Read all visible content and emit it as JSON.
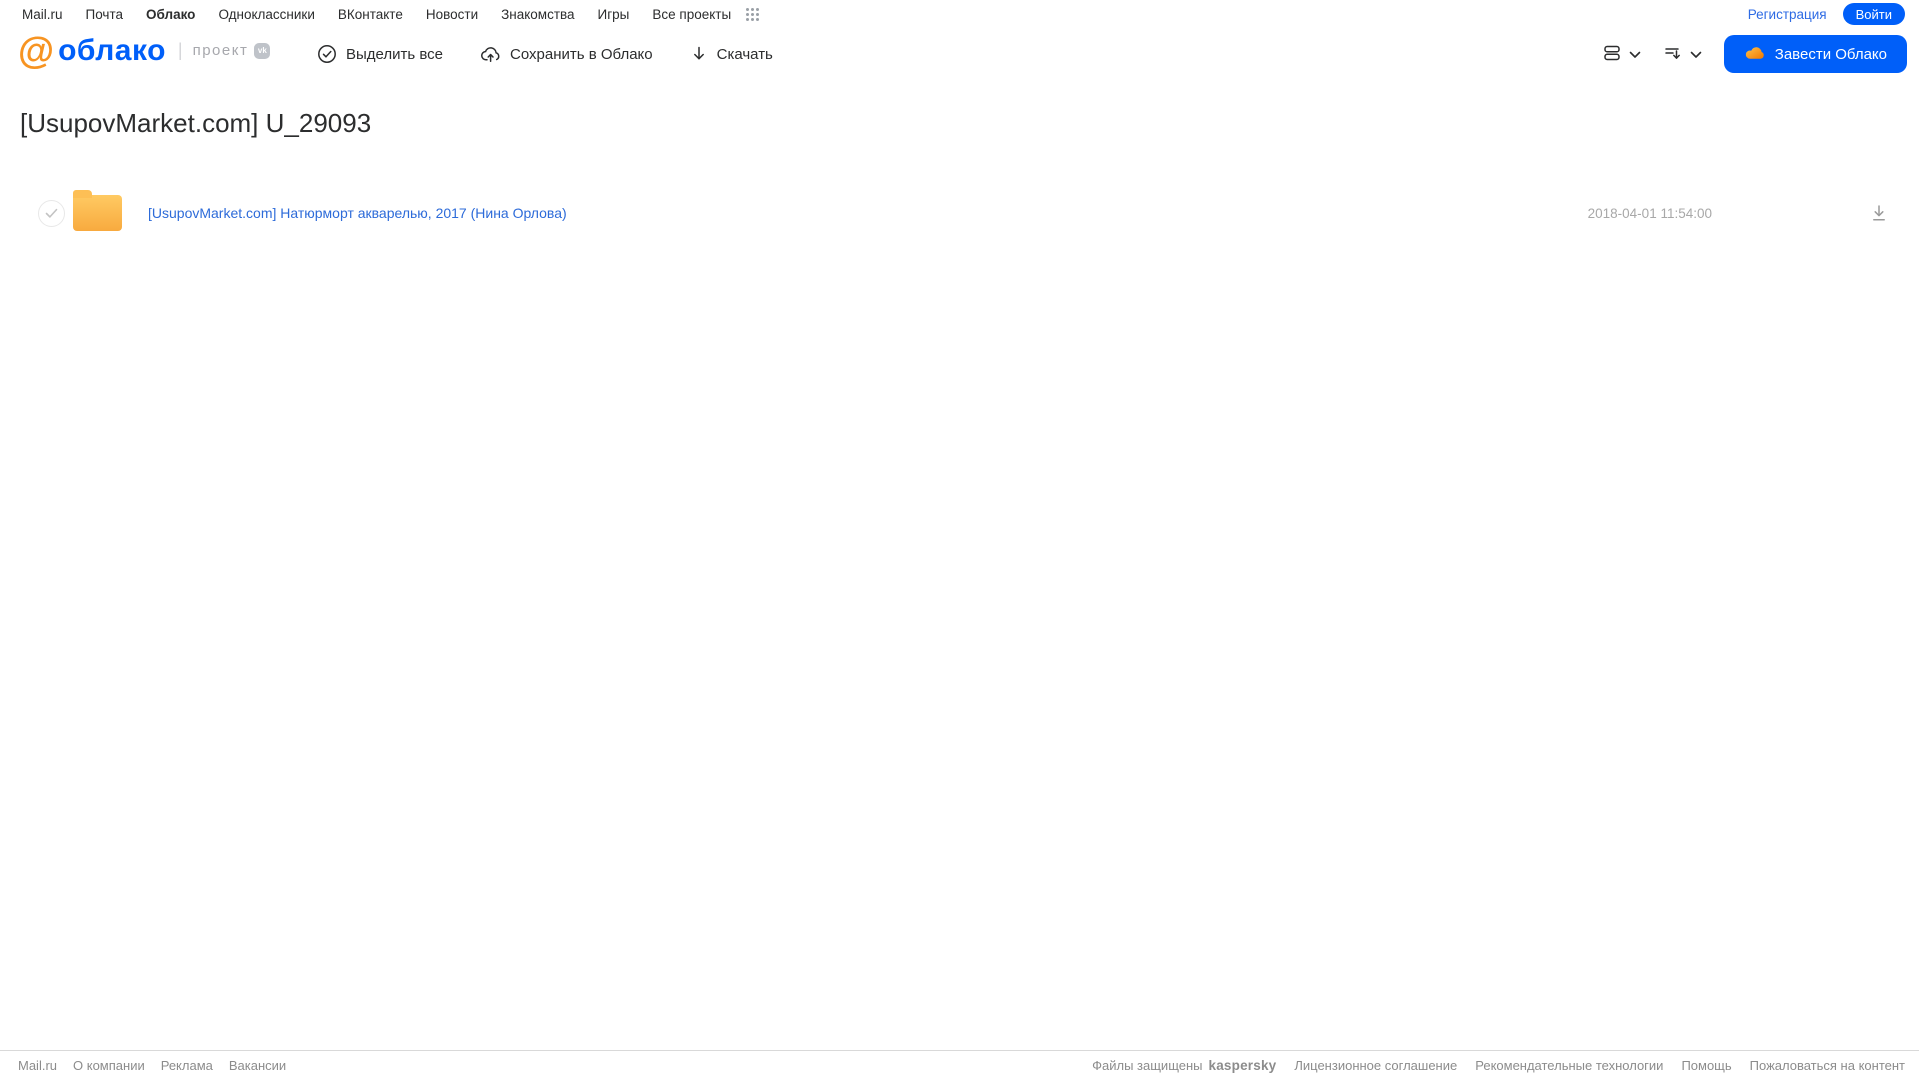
{
  "topbar": {
    "links": [
      "Mail.ru",
      "Почта",
      "Облако",
      "Одноклассники",
      "ВКонтакте",
      "Новости",
      "Знакомства",
      "Игры",
      "Все проекты"
    ],
    "registration": "Регистрация",
    "login": "Войти"
  },
  "header": {
    "logo_at": "@",
    "logo_text": "облако",
    "project_label": "проект",
    "vk_badge": "vk",
    "toolbar": {
      "select_all": "Выделить все",
      "save_to_cloud": "Сохранить в Облако",
      "download": "Скачать"
    },
    "get_cloud_button": "Завести Облако"
  },
  "page": {
    "title": "[UsupovMarket.com] U_29093"
  },
  "files": [
    {
      "name": "[UsupovMarket.com] Натюрморт акварелью, 2017 (Нина Орлова)",
      "date": "2018-04-01 11:54:00"
    }
  ],
  "footer": {
    "left_links": [
      "Mail.ru",
      "О компании",
      "Реклама",
      "Вакансии"
    ],
    "protected_text": "Файлы защищены",
    "kaspersky": "kaspersky",
    "right_links": [
      "Лицензионное соглашение",
      "Рекомендательные технологии",
      "Помощь",
      "Пожаловаться на контент"
    ]
  },
  "colors": {
    "accent_blue": "#005ff9",
    "link_blue": "#2d6bd9",
    "kaspersky_green": "#006d5c",
    "folder_orange": "#f8aa3f"
  }
}
